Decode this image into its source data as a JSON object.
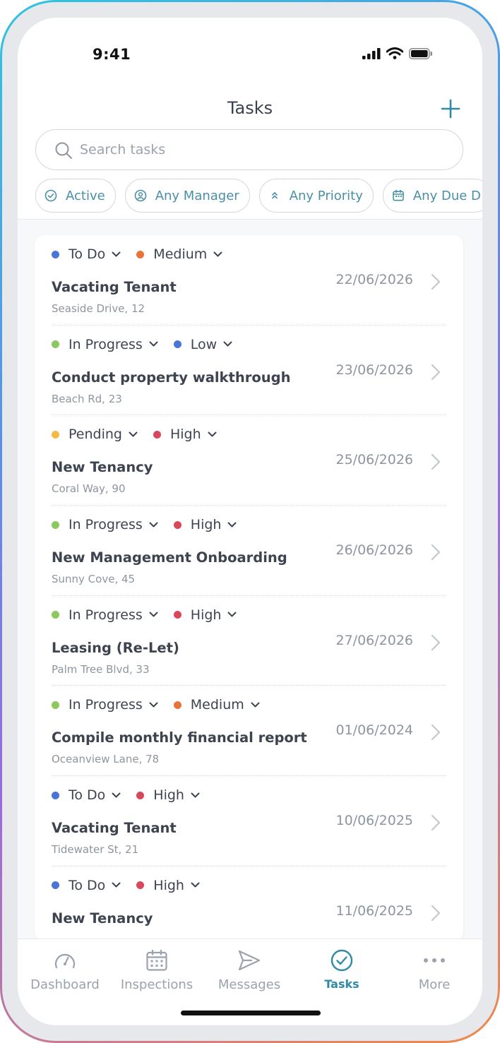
{
  "status_bar": {
    "time": "9:41"
  },
  "header": {
    "title": "Tasks"
  },
  "search": {
    "placeholder": "Search tasks"
  },
  "filters": [
    {
      "label": "Active",
      "icon": "check-circle-icon"
    },
    {
      "label": "Any Manager",
      "icon": "user-circle-icon"
    },
    {
      "label": "Any Priority",
      "icon": "chevrons-up-icon"
    },
    {
      "label": "Any Due D",
      "icon": "calendar-icon"
    }
  ],
  "colors": {
    "accent": "#2e8aa6",
    "to_do": "#4a74d6",
    "in_progress": "#8cc85c",
    "pending": "#f5b94a",
    "low": "#4a74d6",
    "medium": "#e8743b",
    "high": "#d9485a"
  },
  "tasks": [
    {
      "status": "To Do",
      "status_color": "#4a74d6",
      "priority": "Medium",
      "priority_color": "#e8743b",
      "name": "Vacating Tenant",
      "address": "Seaside Drive, 12",
      "date": "22/06/2026"
    },
    {
      "status": "In Progress",
      "status_color": "#8cc85c",
      "priority": "Low",
      "priority_color": "#4a74d6",
      "name": "Conduct property walkthrough",
      "address": "Beach Rd, 23",
      "date": "23/06/2026"
    },
    {
      "status": "Pending",
      "status_color": "#f5b94a",
      "priority": "High",
      "priority_color": "#d9485a",
      "name": "New Tenancy",
      "address": "Coral Way, 90",
      "date": "25/06/2026"
    },
    {
      "status": "In Progress",
      "status_color": "#8cc85c",
      "priority": "High",
      "priority_color": "#d9485a",
      "name": "New Management Onboarding",
      "address": "Sunny Cove, 45",
      "date": "26/06/2026"
    },
    {
      "status": "In Progress",
      "status_color": "#8cc85c",
      "priority": "High",
      "priority_color": "#d9485a",
      "name": "Leasing (Re-Let)",
      "address": "Palm Tree Blvd, 33",
      "date": "27/06/2026"
    },
    {
      "status": "In Progress",
      "status_color": "#8cc85c",
      "priority": "Medium",
      "priority_color": "#e8743b",
      "name": "Compile monthly financial report",
      "address": "Oceanview Lane, 78",
      "date": "01/06/2024"
    },
    {
      "status": "To Do",
      "status_color": "#4a74d6",
      "priority": "High",
      "priority_color": "#d9485a",
      "name": "Vacating Tenant",
      "address": "Tidewater St, 21",
      "date": "10/06/2025"
    },
    {
      "status": "To Do",
      "status_color": "#4a74d6",
      "priority": "High",
      "priority_color": "#d9485a",
      "name": "New Tenancy",
      "address": "",
      "date": "11/06/2025"
    }
  ],
  "bottom_nav": [
    {
      "label": "Dashboard",
      "icon": "gauge-icon"
    },
    {
      "label": "Inspections",
      "icon": "calendar-grid-icon"
    },
    {
      "label": "Messages",
      "icon": "send-icon"
    },
    {
      "label": "Tasks",
      "icon": "check-circle-icon",
      "active": true
    },
    {
      "label": "More",
      "icon": "more-dots-icon"
    }
  ]
}
